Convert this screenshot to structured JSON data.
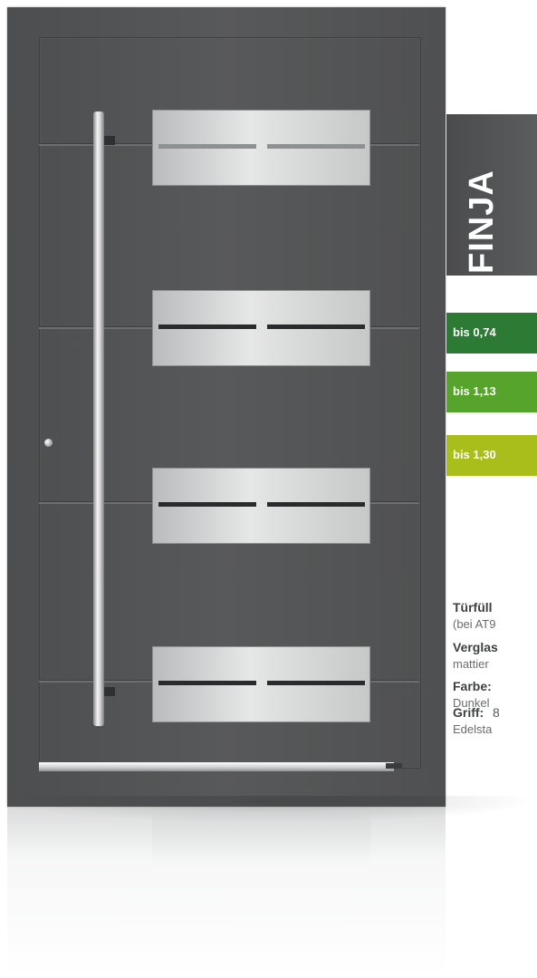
{
  "model": {
    "name": "FINJA"
  },
  "u_values": [
    {
      "label": "bis 0,74",
      "color": "#2c7a33"
    },
    {
      "label": "bis 1,13",
      "color": "#56a42c"
    },
    {
      "label": "bis 1,30",
      "color": "#a9bd1b"
    }
  ],
  "specs": {
    "fill": {
      "title": "Türfüll",
      "detail": "(bei AT9"
    },
    "glazing": {
      "title": "Verglas",
      "detail": "mattier"
    },
    "color": {
      "title": "Farbe:",
      "detail": "Dunkel"
    },
    "handle": {
      "title": "Griff:",
      "value": "8",
      "detail": "Edelsta"
    }
  },
  "colors": {
    "door": "#535455",
    "tab_dark": "#4a4b4c"
  }
}
